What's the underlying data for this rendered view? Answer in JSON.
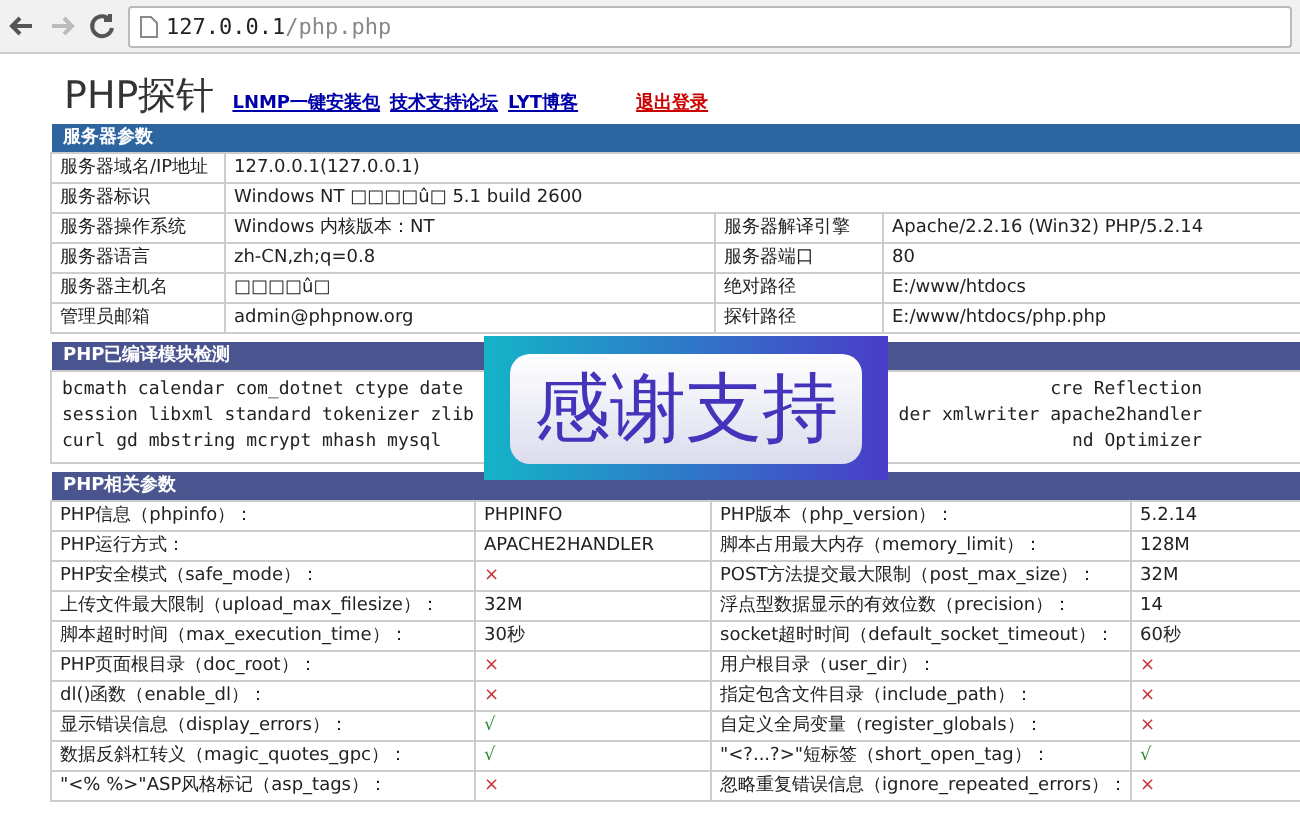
{
  "browser": {
    "url_host": "127.0.0.1",
    "url_path": "/php.php"
  },
  "header": {
    "title": "PHP探针",
    "links": [
      {
        "label": "LNMP一键安装包",
        "kind": "normal"
      },
      {
        "label": "技术支持论坛",
        "kind": "normal"
      },
      {
        "label": "LYT博客",
        "kind": "normal"
      },
      {
        "label": "退出登录",
        "kind": "danger"
      }
    ]
  },
  "server": {
    "title": "服务器参数",
    "rows": [
      [
        {
          "label": "服务器域名/IP地址",
          "value": "127.0.0.1(127.0.0.1)"
        }
      ],
      [
        {
          "label": "服务器标识",
          "value": "Windows NT □□□□û□ 5.1 build 2600"
        }
      ],
      [
        {
          "label": "服务器操作系统",
          "value": "Windows  内核版本：NT"
        },
        {
          "label": "服务器解译引擎",
          "value": "Apache/2.2.16 (Win32) PHP/5.2.14"
        }
      ],
      [
        {
          "label": "服务器语言",
          "value": "zh-CN,zh;q=0.8"
        },
        {
          "label": "服务器端口",
          "value": "80"
        }
      ],
      [
        {
          "label": "服务器主机名",
          "value": "□□□□û□"
        },
        {
          "label": "绝对路径",
          "value": "E:/www/htdocs"
        }
      ],
      [
        {
          "label": "管理员邮箱",
          "value": "admin@phpnow.org"
        },
        {
          "label": "探针路径",
          "value": "E:/www/htdocs/php.php"
        }
      ]
    ]
  },
  "modules": {
    "title": "PHP已编译模块检测",
    "lines": [
      {
        "left": "bcmath calendar com_dotnet ctype date",
        "right": "cre Reflection"
      },
      {
        "left": "session libxml standard tokenizer zlib",
        "right": "der xmlwriter apache2handler"
      },
      {
        "left": "curl gd mbstring mcrypt mhash mysql",
        "right": "nd Optimizer"
      }
    ]
  },
  "php": {
    "title": "PHP相关参数",
    "rows": [
      [
        {
          "label": "PHP信息（phpinfo）：",
          "value": "PHPINFO",
          "kind": "text"
        },
        {
          "label": "PHP版本（php_version）：",
          "value": "5.2.14",
          "kind": "text"
        }
      ],
      [
        {
          "label": "PHP运行方式：",
          "value": "APACHE2HANDLER",
          "kind": "text"
        },
        {
          "label": "脚本占用最大内存（memory_limit）：",
          "value": "128M",
          "kind": "text"
        }
      ],
      [
        {
          "label": "PHP安全模式（safe_mode）：",
          "value": "×",
          "kind": "cross"
        },
        {
          "label": "POST方法提交最大限制（post_max_size）：",
          "value": "32M",
          "kind": "text"
        }
      ],
      [
        {
          "label": "上传文件最大限制（upload_max_filesize）：",
          "value": "32M",
          "kind": "text"
        },
        {
          "label": "浮点型数据显示的有效位数（precision）：",
          "value": "14",
          "kind": "text"
        }
      ],
      [
        {
          "label": "脚本超时时间（max_execution_time）：",
          "value": "30秒",
          "kind": "text"
        },
        {
          "label": "socket超时时间（default_socket_timeout）：",
          "value": "60秒",
          "kind": "text"
        }
      ],
      [
        {
          "label": "PHP页面根目录（doc_root）：",
          "value": "×",
          "kind": "cross"
        },
        {
          "label": "用户根目录（user_dir）：",
          "value": "×",
          "kind": "cross"
        }
      ],
      [
        {
          "label": "dl()函数（enable_dl）：",
          "value": "×",
          "kind": "cross"
        },
        {
          "label": "指定包含文件目录（include_path）：",
          "value": "×",
          "kind": "cross"
        }
      ],
      [
        {
          "label": "显示错误信息（display_errors）：",
          "value": "√",
          "kind": "check"
        },
        {
          "label": "自定义全局变量（register_globals）：",
          "value": "×",
          "kind": "cross"
        }
      ],
      [
        {
          "label": "数据反斜杠转义（magic_quotes_gpc）：",
          "value": "√",
          "kind": "check"
        },
        {
          "label": "\"<?...?>\"短标签（short_open_tag）：",
          "value": "√",
          "kind": "check"
        }
      ],
      [
        {
          "label": "\"<% %>\"ASP风格标记（asp_tags）：",
          "value": "×",
          "kind": "cross"
        },
        {
          "label": "忽略重复错误信息（ignore_repeated_errors）：",
          "value": "×",
          "kind": "cross"
        }
      ]
    ]
  },
  "overlay": {
    "text": "感谢支持"
  }
}
